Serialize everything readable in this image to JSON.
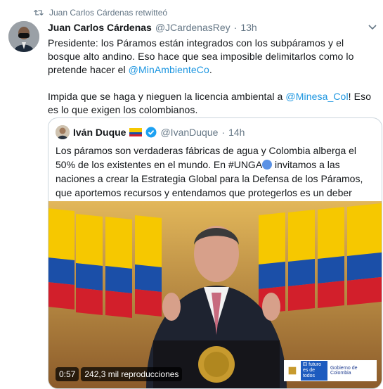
{
  "retweet": {
    "label": "Juan Carlos Cárdenas retwitteó"
  },
  "tweet": {
    "author_name": "Juan Carlos Cárdenas",
    "handle": "@JCardenasRey",
    "separator": "·",
    "time": "13h",
    "para1_before": "Presidente: los Páramos están integrados con los subpáramos y el bosque alto andino. Eso hace que sea imposible delimitarlos como lo pretende hacer el ",
    "para1_link": "@MinAmbienteCo",
    "para1_after": ".",
    "para2_before": "Impida que se haga y nieguen la licencia ambiental a ",
    "para2_link": "@Minesa_Col",
    "para2_after": "! Eso es lo que exigen los colombianos."
  },
  "quoted": {
    "author_name": "Iván Duque",
    "handle": "@IvanDuque",
    "separator": "·",
    "time": "14h",
    "text_before": "Los páramos son verdaderas fábricas de agua y Colombia alberga el 50% de los existentes en el mundo. En #UNGA",
    "text_after": " invitamos a las naciones a crear la Estrategia Global para la Defensa de los Páramos, que aportemos recursos y entendamos que protegerlos es un deber universal",
    "video_duration": "0:57",
    "video_views": "242,3 mil reproducciones",
    "logo_text_1": "El futuro",
    "logo_text_2": "es de todos",
    "logo_text_3": "Gobierno de Colombia"
  },
  "icons": [
    "retweet-icon",
    "chevron-down-icon",
    "verified-icon",
    "colombia-flag-icon",
    "un-emoji-icon"
  ],
  "colors": {
    "link": "#1b95e0",
    "secondary": "#657786",
    "border": "#ccd6dd"
  }
}
